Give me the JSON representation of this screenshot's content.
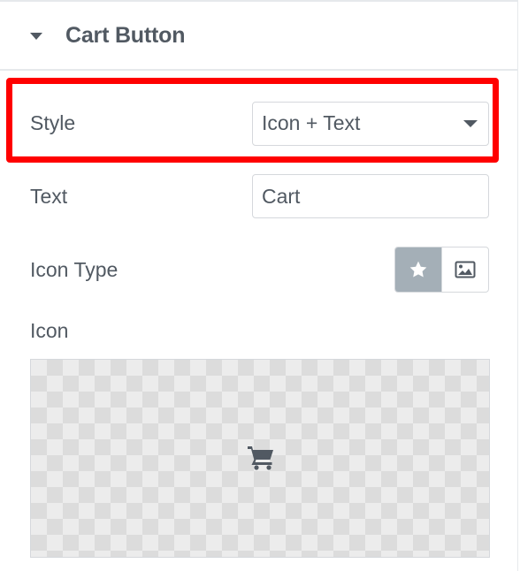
{
  "section": {
    "title": "Cart Button",
    "caret_icon": "caret-down-icon"
  },
  "style_field": {
    "label": "Style",
    "value": "Icon + Text",
    "dropdown_icon": "chevron-down-icon"
  },
  "text_field": {
    "label": "Text",
    "value": "Cart"
  },
  "icon_type_field": {
    "label": "Icon Type",
    "options": [
      {
        "icon": "star-icon",
        "active": true
      },
      {
        "icon": "image-icon",
        "active": false
      }
    ]
  },
  "icon_field": {
    "label": "Icon",
    "preview_icon": "shopping-cart-icon"
  },
  "colors": {
    "text": "#515962",
    "highlight": "#ff0000",
    "active_choice": "#a4afb7",
    "border": "#d5d8dc"
  }
}
